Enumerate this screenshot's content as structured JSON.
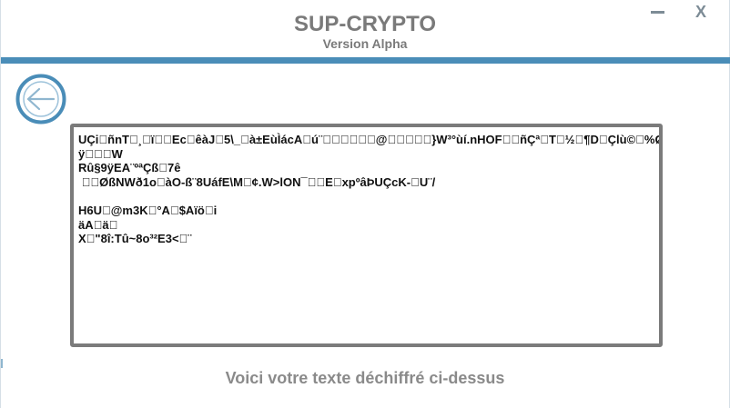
{
  "header": {
    "title": "SUP-CRYPTO",
    "subtitle": "Version Alpha"
  },
  "window_controls": {
    "minimize_icon": "minimize-icon",
    "close_label": "X"
  },
  "back_button": {
    "icon": "arrow-left-icon"
  },
  "output": {
    "text": "UÇi\u0000ñnT\u0000¸\u0000ï\u0000\u0000Ec\u0000êàJ\u00005\\_\u0000à±EùÌácA\u0000ú¨\u0000\u0000\u0000\u0000\u0000\u0000@\u0000\u0000\u0000\u0000\u0000}W³°ùí.nHOF\u0000\u0000ñÇª\u0000T\u0000½\u0000¶D\u0000Çlù©\u0000%Ø\nÿ\u0000\u0000\u0000W\nRû§9ÿEA¨ºªÇß\u00007ê\n \u0000\u0000ØßNWð1o\u0000àO-ß¨8UáfE\\M\u0000¢.W>lON¯\u0000\u0000E\u0000xpºâÞUÇcK-\u0000U¨/\n\nH6U\u0000@m3K\u0000°A\u0000$Aïö\u0000i\näA\u0000ä\u0000\nX\u0000\"8î:Tû~8o³²E3<\u0000¨"
  },
  "caption": "Voici votre texte déchiffré ci-dessus",
  "colors": {
    "accent": "#4a8db8",
    "title_gray": "#7a7a7a",
    "panel_border": "#7b7b7b"
  }
}
